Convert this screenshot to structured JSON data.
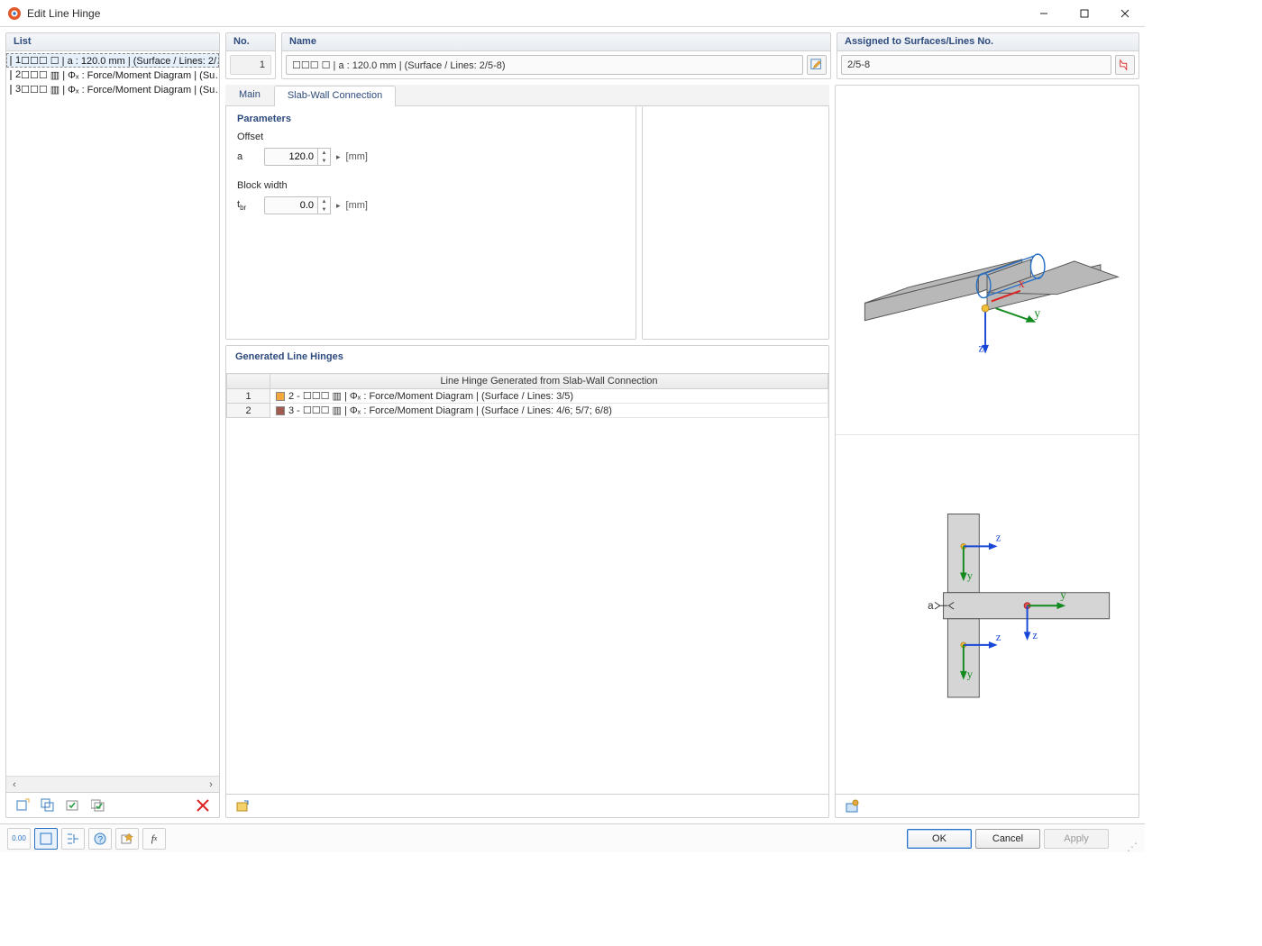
{
  "window": {
    "title": "Edit Line Hinge"
  },
  "left": {
    "header": "List",
    "items": [
      {
        "num": "1",
        "color": "blue",
        "text": "☐☐☐ ☐ | a : 120.0 mm | (Surface / Lines: 2/…",
        "selected": true
      },
      {
        "num": "2",
        "color": "orange",
        "text": "☐☐☐ ▥ | Φₓ : Force/Moment Diagram | (Su…",
        "selected": false
      },
      {
        "num": "3",
        "color": "brown",
        "text": "☐☐☐ ▥ | Φₓ : Force/Moment Diagram | (Su…",
        "selected": false
      }
    ]
  },
  "top": {
    "no_label": "No.",
    "no_value": "1",
    "name_label": "Name",
    "name_value": "☐☐☐ ☐ | a : 120.0 mm | (Surface / Lines: 2/5-8)",
    "assigned_label": "Assigned to Surfaces/Lines No.",
    "assigned_value": "2/5-8"
  },
  "tabs": {
    "main": "Main",
    "slab": "Slab-Wall Connection"
  },
  "params": {
    "header": "Parameters",
    "offset_label": "Offset",
    "offset_sym": "a",
    "offset_value": "120.0",
    "offset_unit": "[mm]",
    "block_label": "Block width",
    "block_sym_html": "t<sub>br</sub>",
    "block_value": "0.0",
    "block_unit": "[mm]"
  },
  "generated": {
    "header": "Generated Line Hinges",
    "col_header": "Line Hinge Generated from Slab-Wall Connection",
    "rows": [
      {
        "idx": "1",
        "color": "orange",
        "text": "2 - ☐☐☐ ▥ | Φₓ : Force/Moment Diagram | (Surface / Lines: 3/5)"
      },
      {
        "idx": "2",
        "color": "brown",
        "text": "3 - ☐☐☐ ▥ | Φₓ : Force/Moment Diagram | (Surface / Lines: 4/6; 5/7; 6/8)"
      }
    ]
  },
  "buttons": {
    "ok": "OK",
    "cancel": "Cancel",
    "apply": "Apply"
  }
}
